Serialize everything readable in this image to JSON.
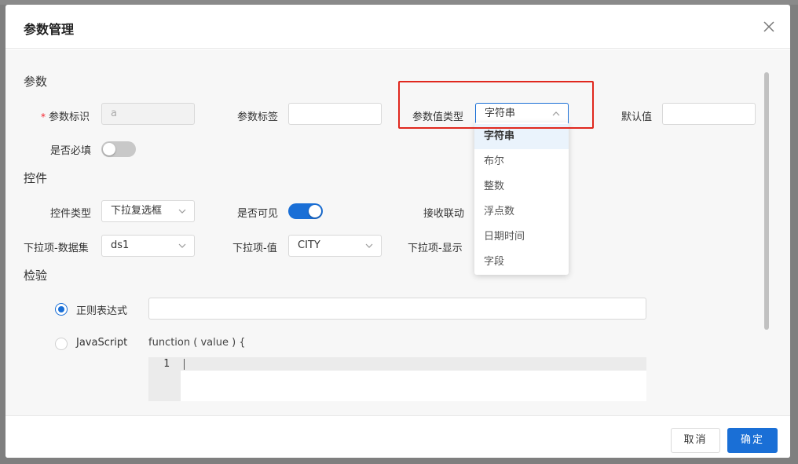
{
  "dialog": {
    "title": "参数管理"
  },
  "params_section": {
    "title": "参数",
    "param_id_label": "参数标识",
    "param_id_value": "a",
    "param_tag_label": "参数标签",
    "param_tag_value": "",
    "value_type_label": "参数值类型",
    "value_type_selected": "字符串",
    "default_label": "默认值",
    "default_value": "",
    "required_label": "是否必填",
    "required_on": false
  },
  "value_type_options": [
    "字符串",
    "布尔",
    "整数",
    "浮点数",
    "日期时间",
    "字段"
  ],
  "control_section": {
    "title": "控件",
    "control_type_label": "控件类型",
    "control_type_value": "下拉复选框",
    "visible_label": "是否可见",
    "visible_on": true,
    "linkage_label": "接收联动",
    "dataset_label": "下拉项-数据集",
    "dataset_value": "ds1",
    "value_label": "下拉项-值",
    "value_value": "CITY",
    "display_label": "下拉项-显示"
  },
  "validation_section": {
    "title": "检验",
    "regex_label": "正则表达式",
    "regex_value": "",
    "js_label": "JavaScript",
    "function_header": "function ( value ) {",
    "line_number": "1"
  },
  "footer": {
    "cancel_label": "取消",
    "ok_label": "确定"
  },
  "colors": {
    "accent": "#1a6fd6",
    "highlight": "#e0281e"
  }
}
